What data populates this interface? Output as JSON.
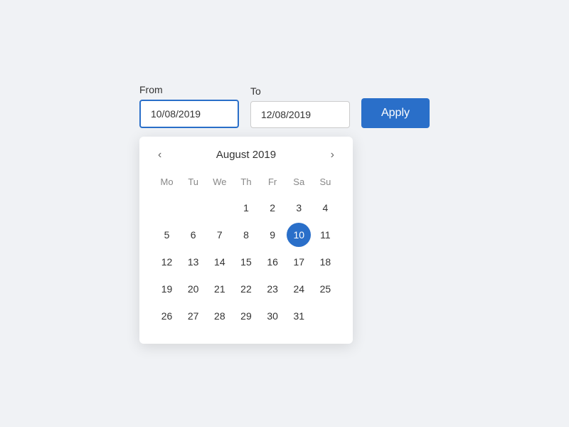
{
  "header": {
    "from_label": "From",
    "to_label": "To",
    "from_value": "10/08/2019",
    "to_value": "12/08/2019",
    "apply_label": "Apply"
  },
  "calendar": {
    "month_title": "August 2019",
    "day_headers": [
      "Mo",
      "Tu",
      "We",
      "Th",
      "Fr",
      "Sa",
      "Su"
    ],
    "selected_day": 10,
    "weeks": [
      [
        null,
        null,
        null,
        1,
        2,
        3,
        4
      ],
      [
        5,
        6,
        7,
        8,
        9,
        10,
        11
      ],
      [
        12,
        13,
        14,
        15,
        16,
        17,
        18
      ],
      [
        19,
        20,
        21,
        22,
        23,
        24,
        25
      ],
      [
        26,
        27,
        28,
        29,
        30,
        31,
        null
      ]
    ],
    "prev_label": "‹",
    "next_label": "›"
  }
}
